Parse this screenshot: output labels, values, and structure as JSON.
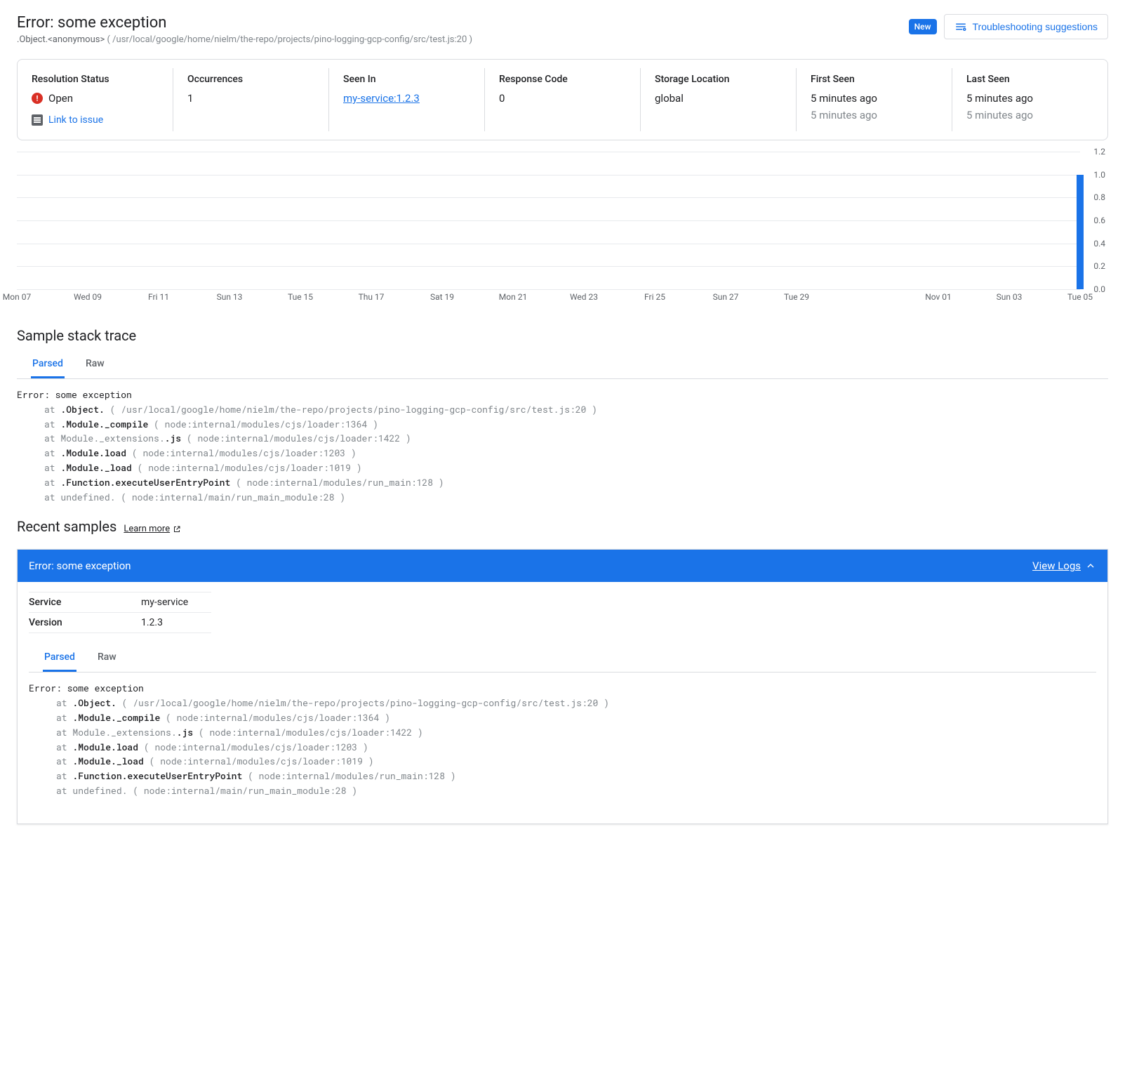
{
  "header": {
    "title": "Error: some exception",
    "subtitle_prefix": ".Object.<anonymous>",
    "subtitle_paren": "( /usr/local/google/home/nielm/the-repo/projects/pino-logging-gcp-config/src/test.js:20 )",
    "badge_new": "New",
    "troubleshooting_label": "Troubleshooting suggestions"
  },
  "summary": {
    "resolution": {
      "label": "Resolution Status",
      "value": "Open",
      "link_issue": "Link to issue"
    },
    "occurrences": {
      "label": "Occurrences",
      "value": "1"
    },
    "seen_in": {
      "label": "Seen In",
      "value": "my-service:1.2.3"
    },
    "response_code": {
      "label": "Response Code",
      "value": "0"
    },
    "storage_location": {
      "label": "Storage Location",
      "value": "global"
    },
    "first_seen": {
      "label": "First Seen",
      "value": "5 minutes ago",
      "sub": "5 minutes ago"
    },
    "last_seen": {
      "label": "Last Seen",
      "value": "5 minutes ago",
      "sub": "5 minutes ago"
    }
  },
  "chart_data": {
    "type": "bar",
    "categories": [
      "Mon 07",
      "Wed 09",
      "Fri 11",
      "Sun 13",
      "Tue 15",
      "Thu 17",
      "Sat 19",
      "Mon 21",
      "Wed 23",
      "Fri 25",
      "Sun 27",
      "Tue 29",
      "",
      "Nov 01",
      "Sun 03",
      "Tue 05"
    ],
    "series": [
      {
        "name": "Occurrences",
        "x": "Tue 05",
        "value": 1.0
      }
    ],
    "ylim": [
      0,
      1.2
    ],
    "yticks": [
      0,
      0.2,
      0.4,
      0.6,
      0.8,
      1.0,
      1.2
    ],
    "xlabel": "",
    "ylabel": "",
    "title": ""
  },
  "stack_section": {
    "title": "Sample stack trace",
    "tabs": {
      "parsed": "Parsed",
      "raw": "Raw"
    },
    "first_line": "Error: some exception",
    "frames": [
      {
        "prefix": "     at ",
        "fn": ".Object.<anonymous>",
        "loc": " ( /usr/local/google/home/nielm/the-repo/projects/pino-logging-gcp-config/src/test.js:20 )"
      },
      {
        "prefix": "     at ",
        "fn": ".Module._compile",
        "loc": " ( node:internal/modules/cjs/loader:1364 )"
      },
      {
        "prefix": "     at ",
        "fn_dim": "Module._extensions.",
        "fn": ".js",
        "loc": " ( node:internal/modules/cjs/loader:1422 )"
      },
      {
        "prefix": "     at ",
        "fn": ".Module.load",
        "loc": " ( node:internal/modules/cjs/loader:1203 )"
      },
      {
        "prefix": "     at ",
        "fn": ".Module._load",
        "loc": " ( node:internal/modules/cjs/loader:1019 )"
      },
      {
        "prefix": "     at ",
        "fn": ".Function.executeUserEntryPoint",
        "loc": " ( node:internal/modules/run_main:128 )"
      },
      {
        "prefix": "     at ",
        "fn_dim": "undefined.",
        "loc": " ( node:internal/main/run_main_module:28 )"
      }
    ]
  },
  "recent": {
    "title": "Recent samples",
    "learn_more": "Learn more",
    "sample_title": "Error: some exception",
    "view_logs": "View Logs",
    "kv": {
      "service_k": "Service",
      "service_v": "my-service",
      "version_k": "Version",
      "version_v": "1.2.3"
    }
  }
}
